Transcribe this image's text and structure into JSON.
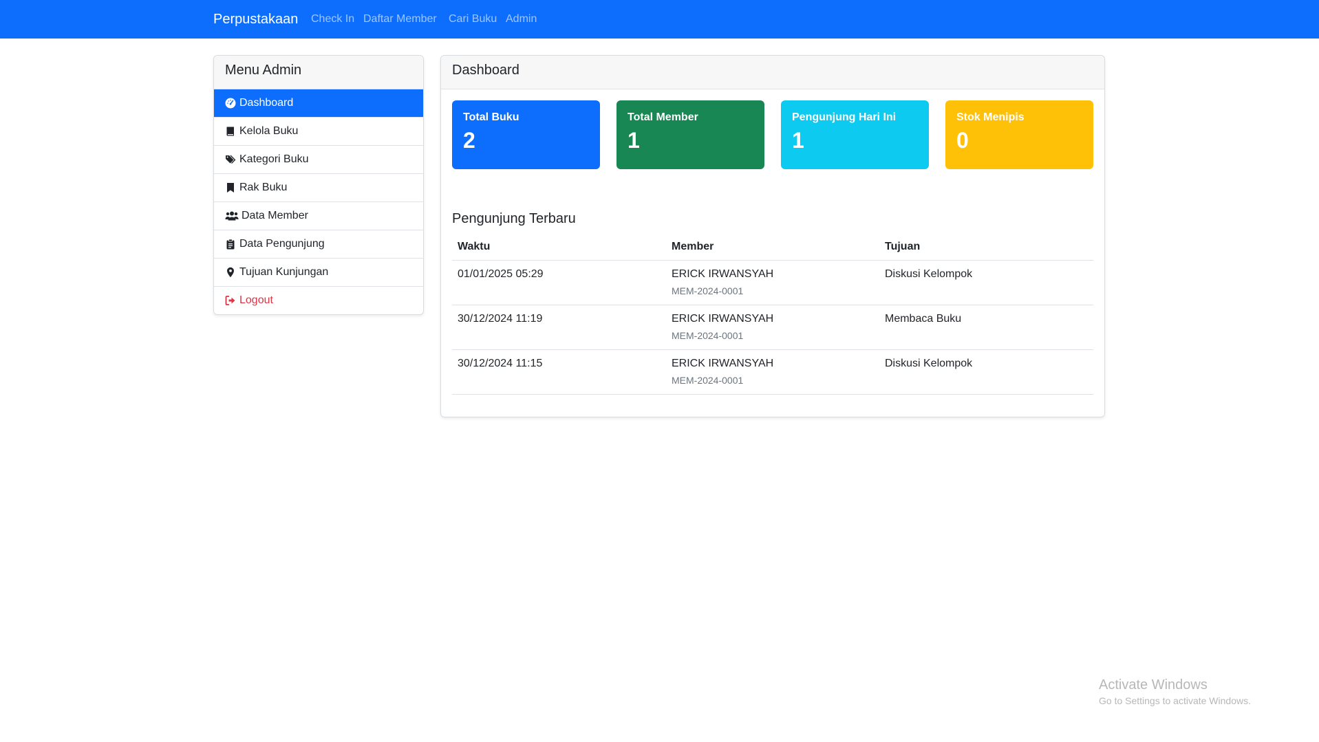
{
  "navbar": {
    "brand": "Perpustakaan",
    "links": [
      "Check In",
      "Daftar Member",
      "Cari Buku",
      "Admin"
    ]
  },
  "sidebar": {
    "title": "Menu Admin",
    "items": [
      {
        "label": "Dashboard",
        "icon": "gauge-icon",
        "active": true
      },
      {
        "label": "Kelola Buku",
        "icon": "book-icon"
      },
      {
        "label": "Kategori Buku",
        "icon": "tags-icon"
      },
      {
        "label": "Rak Buku",
        "icon": "bookmark-icon"
      },
      {
        "label": "Data Member",
        "icon": "users-icon"
      },
      {
        "label": "Data Pengunjung",
        "icon": "clipboard-icon"
      },
      {
        "label": "Tujuan Kunjungan",
        "icon": "map-marker-icon"
      },
      {
        "label": "Logout",
        "icon": "sign-out-icon"
      }
    ]
  },
  "main": {
    "title": "Dashboard",
    "stats": [
      {
        "label": "Total Buku",
        "value": "2",
        "color": "#0d6efd"
      },
      {
        "label": "Total Member",
        "value": "1",
        "color": "#198754"
      },
      {
        "label": "Pengunjung Hari Ini",
        "value": "1",
        "color": "#0dcaf0"
      },
      {
        "label": "Stok Menipis",
        "value": "0",
        "color": "#ffc107"
      }
    ],
    "recent": {
      "title": "Pengunjung Terbaru",
      "columns": [
        "Waktu",
        "Member",
        "Tujuan"
      ],
      "rows": [
        {
          "time": "01/01/2025 05:29",
          "member": "ERICK IRWANSYAH",
          "member_id": "MEM-2024-0001",
          "purpose": "Diskusi Kelompok"
        },
        {
          "time": "30/12/2024 11:19",
          "member": "ERICK IRWANSYAH",
          "member_id": "MEM-2024-0001",
          "purpose": "Membaca Buku"
        },
        {
          "time": "30/12/2024 11:15",
          "member": "ERICK IRWANSYAH",
          "member_id": "MEM-2024-0001",
          "purpose": "Diskusi Kelompok"
        }
      ]
    }
  },
  "watermark": {
    "title": "Activate Windows",
    "subtitle": "Go to Settings to activate Windows."
  },
  "colors": {
    "primary": "#0d6efd",
    "danger": "#dc3545"
  }
}
